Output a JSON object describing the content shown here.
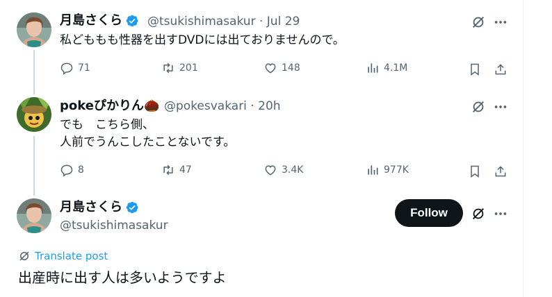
{
  "tweets": [
    {
      "name": "月島さくら",
      "handle": "@tsukishimasakur",
      "sep": "·",
      "time": "Jul 29",
      "text": "私どももも性器を出すDVDには出ておりませんので。",
      "replies": "71",
      "retweets": "201",
      "likes": "148",
      "views": "4.1M",
      "verified": true
    },
    {
      "name": "pokeぴかりん🌰",
      "handle": "@pokesvakari",
      "sep": "·",
      "time": "20h",
      "text": "でも　こちら側、\n人前でうんこしたことないです。",
      "replies": "8",
      "retweets": "47",
      "likes": "3.4K",
      "views": "977K",
      "verified": false
    }
  ],
  "main_tweet": {
    "name": "月島さくら",
    "handle": "@tsukishimasakur",
    "follow_label": "Follow",
    "translate_label": "Translate post",
    "text": "出産時に出す人は多いようですよ"
  },
  "colors": {
    "text": "#0f1419",
    "secondary": "#536471",
    "accent": "#1d9bf0",
    "verified": "#1d9bf0",
    "follow_bg": "#0f1419"
  },
  "icons": [
    "reply-icon",
    "retweet-icon",
    "like-icon",
    "views-icon",
    "bookmark-icon",
    "share-icon",
    "grok-icon",
    "more-icon",
    "verified-badge-icon",
    "translate-icon"
  ]
}
